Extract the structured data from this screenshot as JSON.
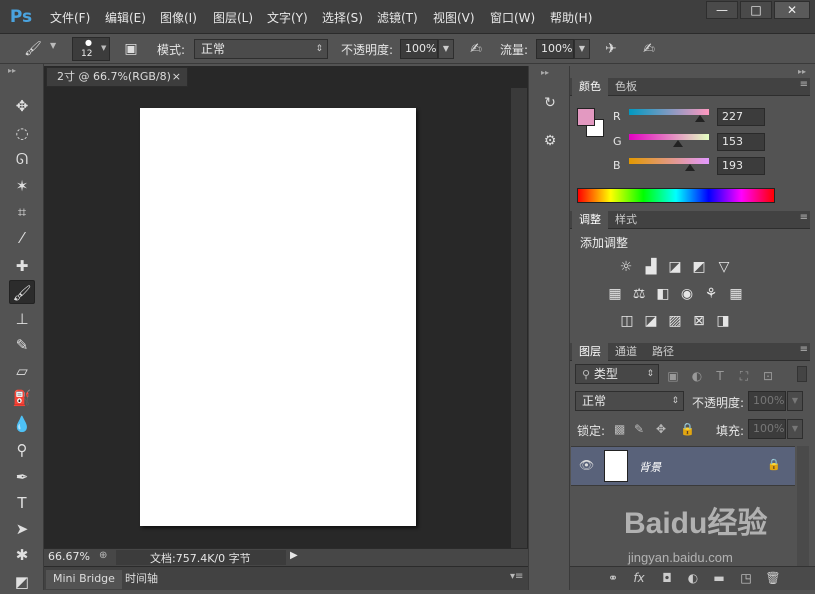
{
  "app": {
    "logo": "Ps"
  },
  "menu": [
    "文件(F)",
    "编辑(E)",
    "图像(I)",
    "图层(L)",
    "文字(Y)",
    "选择(S)",
    "滤镜(T)",
    "视图(V)",
    "窗口(W)",
    "帮助(H)"
  ],
  "window_controls": {
    "minimize": "—",
    "maximize": "□",
    "close": "✕"
  },
  "options": {
    "brush_size": "12",
    "mode_label": "模式:",
    "mode_value": "正常",
    "opacity_label": "不透明度:",
    "opacity_value": "100%",
    "flow_label": "流量:",
    "flow_value": "100%"
  },
  "document": {
    "tab_title": "2寸 @ 66.7%(RGB/8)",
    "tab_close": "×",
    "zoom": "66.67%",
    "doc_info": "文档:757.4K/0 字节"
  },
  "bottom_tabs": [
    "Mini Bridge",
    "时间轴"
  ],
  "color_panel": {
    "tabs": [
      "颜色",
      "色板"
    ],
    "r_label": "R",
    "r_value": "227",
    "g_label": "G",
    "g_value": "153",
    "b_label": "B",
    "b_value": "193",
    "foreground": "#e399c1",
    "background": "#ffffff"
  },
  "adjust_panel": {
    "tabs": [
      "调整",
      "样式"
    ],
    "heading": "添加调整"
  },
  "layers_panel": {
    "tabs": [
      "图层",
      "通道",
      "路径"
    ],
    "filter_kind": "类型",
    "blend_mode": "正常",
    "opacity_label": "不透明度:",
    "opacity_value": "100%",
    "lock_label": "锁定:",
    "fill_label": "填充:",
    "fill_value": "100%",
    "layers": [
      {
        "name": "背景"
      }
    ]
  },
  "watermark": {
    "brand": "Baidu经验",
    "url": "jingyan.baidu.com"
  },
  "colors": {
    "accent": "#4aa3df",
    "selected_layer": "#59627a"
  }
}
